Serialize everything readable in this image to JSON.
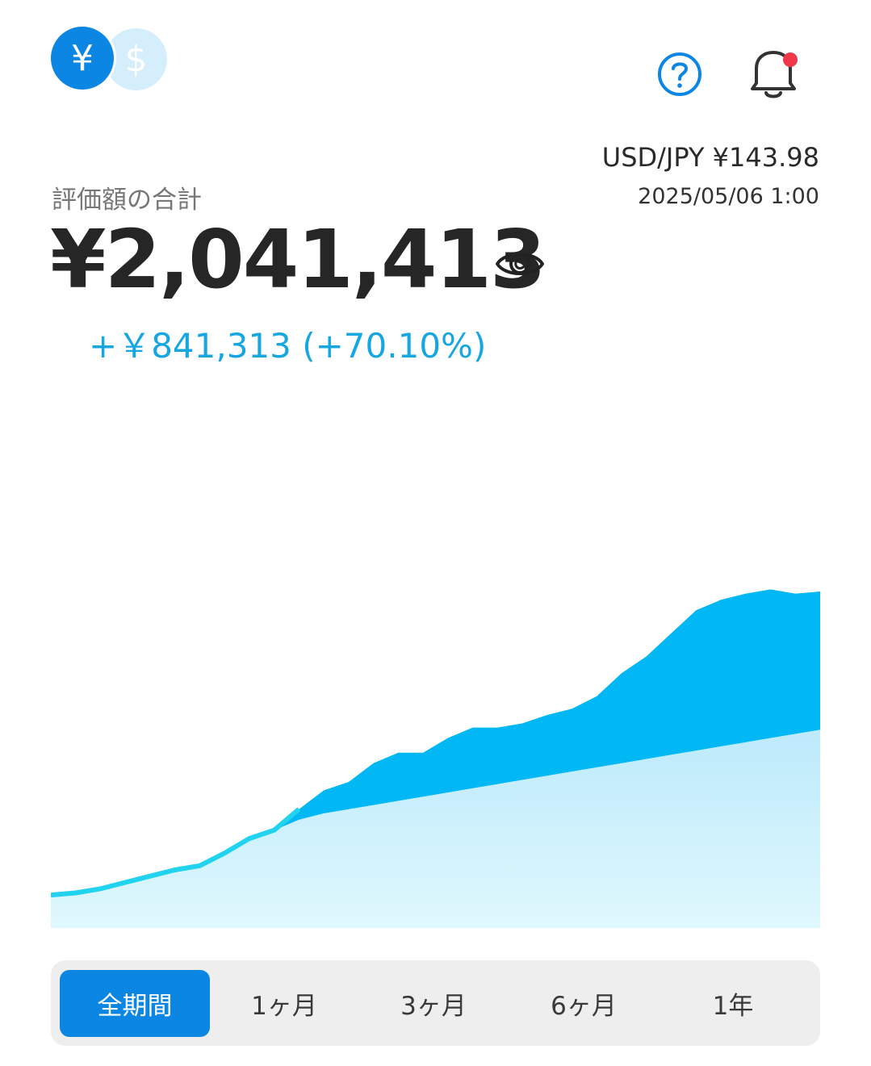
{
  "currency_toggle": {
    "active_symbol": "¥",
    "inactive_symbol": "$"
  },
  "header": {
    "help_icon": "question-circle-icon",
    "bell_icon": "bell-icon",
    "has_notification": true
  },
  "exchange": {
    "rate_text": "USD/JPY ¥143.98",
    "timestamp": "2025/05/06 1:00"
  },
  "summary": {
    "label": "評価額の合計",
    "total": "¥2,041,413",
    "gain": "+￥841,313 (+70.10%)"
  },
  "colors": {
    "accent": "#0b86e2",
    "gain_text": "#17a7e0",
    "value_area": "#01b8f5",
    "principal_area": "#c9f0fc",
    "notification_dot": "#f0384a"
  },
  "chart_data": {
    "type": "area",
    "series": [
      {
        "values": [
          1200,
          1210,
          1230,
          1260,
          1290,
          1320,
          1340,
          1400,
          1470,
          1510,
          1610,
          1700,
          1740,
          1830,
          1880,
          1880,
          1950,
          2000,
          2000,
          2020,
          2060,
          2090,
          2150,
          2260,
          2340,
          2450,
          2560,
          2610,
          2640,
          2660,
          2640,
          2650
        ]
      },
      {
        "values": [
          1200,
          1210,
          1230,
          1260,
          1290,
          1320,
          1340,
          1400,
          1470,
          1510,
          1560,
          1590,
          1610,
          1630,
          1650,
          1670,
          1690,
          1710,
          1730,
          1750,
          1770,
          1790,
          1810,
          1830,
          1850,
          1870,
          1890,
          1910,
          1930,
          1950,
          1970,
          1990
        ]
      }
    ]
  },
  "periods": [
    {
      "label": "全期間",
      "active": true
    },
    {
      "label": "1ヶ月",
      "active": false
    },
    {
      "label": "3ヶ月",
      "active": false
    },
    {
      "label": "6ヶ月",
      "active": false
    },
    {
      "label": "1年",
      "active": false
    }
  ]
}
